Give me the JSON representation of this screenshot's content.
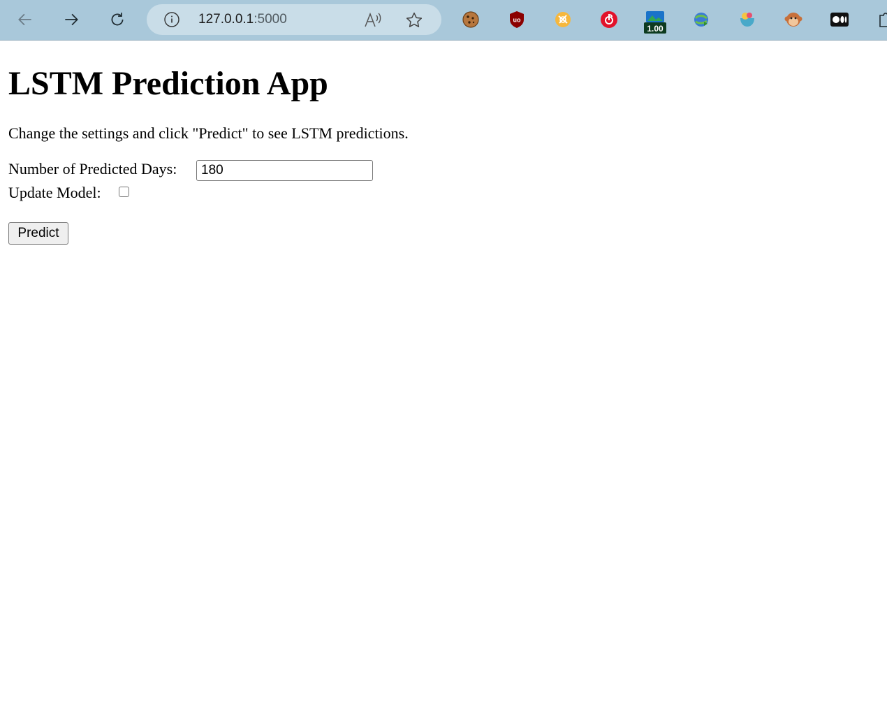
{
  "browser": {
    "url_host": "127.0.0.1",
    "url_port": ":5000",
    "extensions": [
      {
        "name": "cookie-icon"
      },
      {
        "name": "ublock-icon",
        "label": "uo"
      },
      {
        "name": "orange-extension-icon"
      },
      {
        "name": "netease-music-icon"
      },
      {
        "name": "playback-speed-icon",
        "label": "1.00"
      },
      {
        "name": "download-manager-icon"
      },
      {
        "name": "ice-cream-icon"
      },
      {
        "name": "monkey-icon"
      },
      {
        "name": "medium-icon"
      },
      {
        "name": "puzzle-icon"
      }
    ]
  },
  "page": {
    "title": "LSTM Prediction App",
    "intro": "Change the settings and click \"Predict\" to see LSTM predictions.",
    "days_label": "Number of Predicted Days:",
    "days_value": "180",
    "update_label": "Update Model:",
    "update_checked": false,
    "predict_label": "Predict"
  }
}
